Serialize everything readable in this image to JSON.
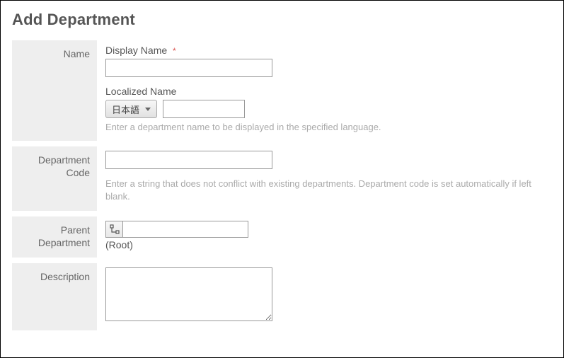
{
  "page": {
    "title": "Add Department"
  },
  "fields": {
    "name": {
      "section_label": "Name",
      "display_label": "Display Name",
      "display_value": "",
      "required_marker": "*",
      "localized_label": "Localized Name",
      "localized_lang_selected": "日本語",
      "localized_value": "",
      "localized_hint": "Enter a department name to be displayed in the specified language."
    },
    "code": {
      "section_label": "Department Code",
      "value": "",
      "hint": "Enter a string that does not conflict with existing departments. Department code is set automatically if left blank."
    },
    "parent": {
      "section_label": "Parent Department",
      "value": "",
      "root_label": "(Root)"
    },
    "description": {
      "section_label": "Description",
      "value": ""
    }
  }
}
